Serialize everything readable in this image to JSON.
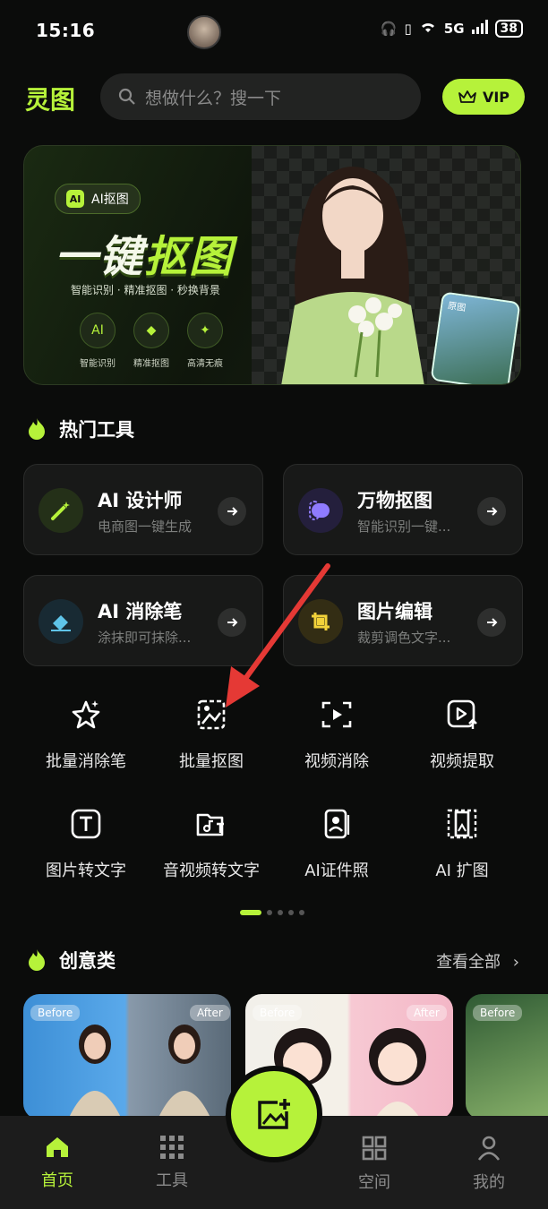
{
  "status_bar": {
    "time": "15:16",
    "network": "5G",
    "battery": "38"
  },
  "header": {
    "logo": "灵图",
    "search_placeholder": "想做什么？搜一下",
    "vip_label": "VIP"
  },
  "banner": {
    "tag": "AI抠图",
    "title_part1": "一键",
    "title_part2": "抠图",
    "subtitle": "智能识别 · 精准抠图 · 秒换背景",
    "features": [
      "智能识别",
      "精准抠图",
      "高清无痕"
    ],
    "thumb_label": "原图"
  },
  "hot_tools": {
    "title": "热门工具",
    "cards": [
      {
        "title": "AI 设计师",
        "subtitle": "电商图一键生成",
        "icon": "magic-wand-icon",
        "color": "#b6f23a"
      },
      {
        "title": "万物抠图",
        "subtitle": "智能识别一键...",
        "icon": "cutout-icon",
        "color": "#8f7bff"
      },
      {
        "title": "AI 消除笔",
        "subtitle": "涂抹即可抹除...",
        "icon": "eraser-icon",
        "color": "#5fc4e8"
      },
      {
        "title": "图片编辑",
        "subtitle": "裁剪调色文字...",
        "icon": "crop-icon",
        "color": "#f2d23a"
      }
    ]
  },
  "grid_tools": [
    {
      "label": "批量消除笔",
      "icon": "star-eraser-icon"
    },
    {
      "label": "批量抠图",
      "icon": "batch-cutout-icon"
    },
    {
      "label": "视频消除",
      "icon": "video-erase-icon"
    },
    {
      "label": "视频提取",
      "icon": "video-extract-icon"
    },
    {
      "label": "图片转文字",
      "icon": "text-icon"
    },
    {
      "label": "音视频转文字",
      "icon": "audio-video-text-icon"
    },
    {
      "label": "AI证件照",
      "icon": "id-photo-icon"
    },
    {
      "label": "AI 扩图",
      "icon": "expand-image-icon"
    }
  ],
  "creative": {
    "title": "创意类",
    "see_all": "查看全部",
    "before_label": "Before",
    "after_label": "After"
  },
  "nav": {
    "items": [
      {
        "label": "首页",
        "icon": "home-icon",
        "active": true
      },
      {
        "label": "工具",
        "icon": "grid-icon",
        "active": false
      },
      {
        "label": "空间",
        "icon": "space-icon",
        "active": false
      },
      {
        "label": "我的",
        "icon": "profile-icon",
        "active": false
      }
    ],
    "fab_icon": "add-image-icon"
  },
  "colors": {
    "accent": "#b6f23a",
    "background": "#0b0c0b",
    "card": "#181918"
  }
}
